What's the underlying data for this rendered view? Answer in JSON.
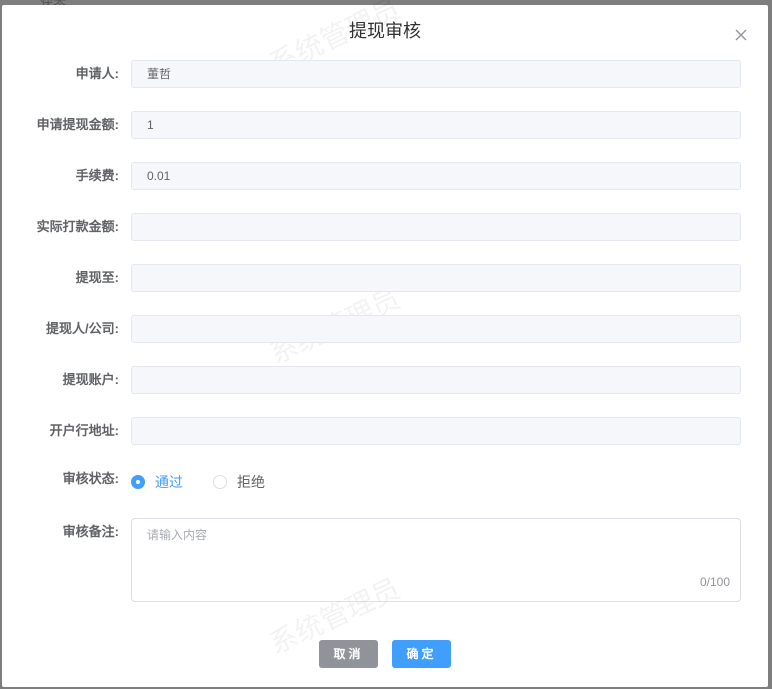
{
  "background": {
    "fragment": "状态"
  },
  "dialog": {
    "title": "提现审核",
    "watermark": "系统管理员",
    "fields": [
      {
        "label": "申请人:",
        "value": "董哲"
      },
      {
        "label": "申请提现金额:",
        "value": "1"
      },
      {
        "label": "手续费:",
        "value": "0.01"
      },
      {
        "label": "实际打款金额:",
        "value": ""
      },
      {
        "label": "提现至:",
        "value": ""
      },
      {
        "label": "提现人/公司:",
        "value": ""
      },
      {
        "label": "提现账户:",
        "value": ""
      },
      {
        "label": "开户行地址:",
        "value": ""
      }
    ],
    "status": {
      "label": "审核状态:",
      "options": [
        "通过",
        "拒绝"
      ],
      "selected": "通过"
    },
    "remark": {
      "label": "审核备注:",
      "placeholder": "请输入内容",
      "counter": "0/100"
    },
    "cancel_label": "取消",
    "confirm_label": "确定",
    "colors": {
      "primary": "#409eff",
      "cancel": "#909399"
    }
  }
}
